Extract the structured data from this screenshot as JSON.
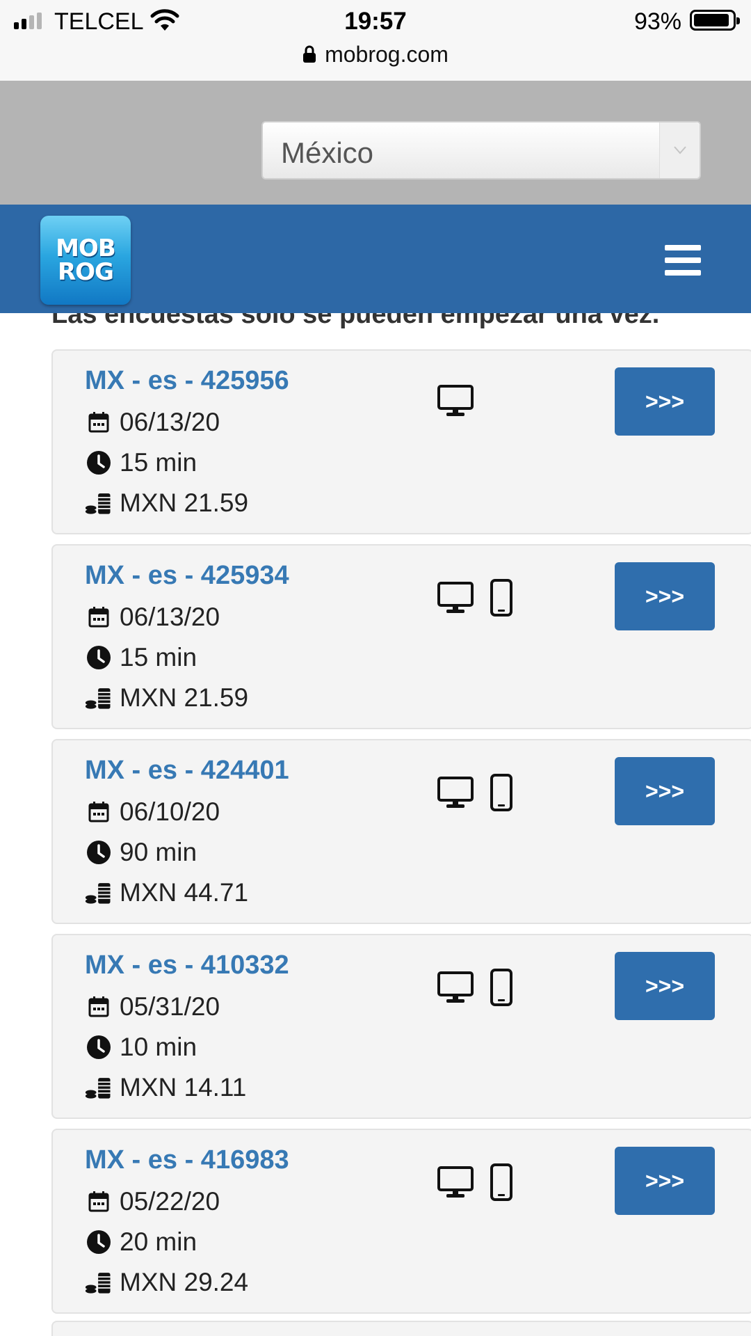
{
  "status_bar": {
    "carrier": "TELCEL",
    "time": "19:57",
    "battery_percent": "93%",
    "battery_level": 0.93,
    "url": "mobrog.com"
  },
  "country_select": {
    "selected": "México"
  },
  "header": {
    "logo_line1": "MOB",
    "logo_line2": "ROG",
    "brand_color": "#2d68a6"
  },
  "notice": "Las encuestas solo se pueden empezar una vez.",
  "surveys": [
    {
      "title": "MX - es - 425956",
      "date": "06/13/20",
      "duration": "15 min",
      "reward": "MXN 21.59",
      "devices": [
        "desktop-icon"
      ],
      "button": ">>>"
    },
    {
      "title": "MX - es - 425934",
      "date": "06/13/20",
      "duration": "15 min",
      "reward": "MXN 21.59",
      "devices": [
        "desktop-icon",
        "mobile-phone-icon"
      ],
      "button": ">>>"
    },
    {
      "title": "MX - es - 424401",
      "date": "06/10/20",
      "duration": "90 min",
      "reward": "MXN 44.71",
      "devices": [
        "desktop-icon",
        "mobile-phone-icon"
      ],
      "button": ">>>"
    },
    {
      "title": "MX - es - 410332",
      "date": "05/31/20",
      "duration": "10 min",
      "reward": "MXN 14.11",
      "devices": [
        "desktop-icon",
        "mobile-phone-icon"
      ],
      "button": ">>>"
    },
    {
      "title": "MX - es - 416983",
      "date": "05/22/20",
      "duration": "20 min",
      "reward": "MXN 29.24",
      "devices": [
        "desktop-icon",
        "mobile-phone-icon"
      ],
      "button": ">>>"
    }
  ]
}
